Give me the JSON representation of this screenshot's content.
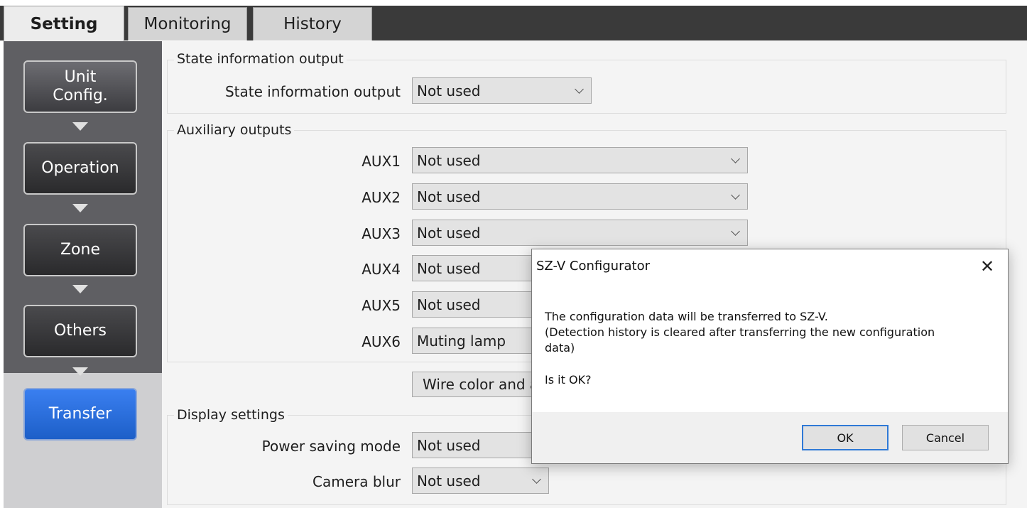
{
  "tabs": {
    "setting": "Setting",
    "monitoring": "Monitoring",
    "history": "History"
  },
  "sidebar": {
    "unit_config": "Unit\nConfig.",
    "operation": "Operation",
    "zone": "Zone",
    "others": "Others",
    "transfer": "Transfer"
  },
  "state_info": {
    "group_title": "State information output",
    "label": "State information output",
    "value": "Not used"
  },
  "aux": {
    "group_title": "Auxiliary outputs",
    "items": [
      {
        "label": "AUX1",
        "value": "Not used"
      },
      {
        "label": "AUX2",
        "value": "Not used"
      },
      {
        "label": "AUX3",
        "value": "Not used"
      },
      {
        "label": "AUX4",
        "value": "Not used"
      },
      {
        "label": "AUX5",
        "value": "Not used"
      },
      {
        "label": "AUX6",
        "value": "Muting lamp"
      }
    ]
  },
  "wire_button": "Wire color and a",
  "display": {
    "group_title": "Display settings",
    "power_saving_label": "Power saving mode",
    "power_saving_value": "Not used",
    "camera_blur_label": "Camera blur",
    "camera_blur_value": "Not used"
  },
  "dialog": {
    "title": "SZ-V Configurator",
    "close": "✕",
    "line1": "The configuration data will be transferred to SZ-V.",
    "line2": "(Detection history is cleared after transferring the new configuration",
    "line3": "data)",
    "question": "Is it OK?",
    "ok": "OK",
    "cancel": "Cancel"
  },
  "colors": {
    "transfer_button": "#2a6fe0",
    "sidebar": "#5f5f63",
    "ok_border": "#2f79d6"
  }
}
